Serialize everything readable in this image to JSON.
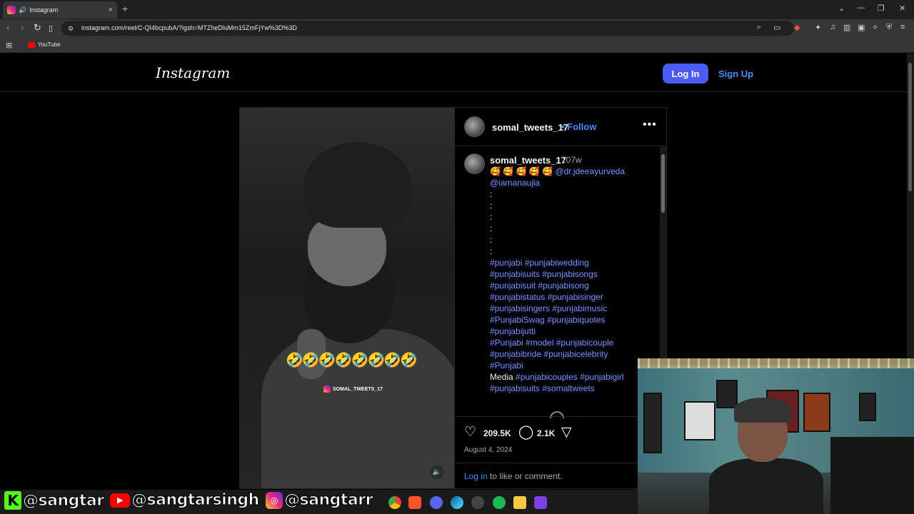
{
  "browser": {
    "tab_title": "Instagram",
    "tab_close": "×",
    "new_tab": "+",
    "url": "instagram.com/reel/C-QI4bcpubA/?igsh=MTZheDluMm15ZmFjYw%3D%3D",
    "bookmark_youtube": "YouTube"
  },
  "header": {
    "logo": "Instagram",
    "login_label": "Log In",
    "signup_label": "Sign Up"
  },
  "video": {
    "emoji_overlay": "🤣🤣🤣🤣🤣🤣🤣🤣",
    "watermark": "SOMAL_TWEETS_17"
  },
  "post": {
    "author": "somal_tweets_17",
    "follow_label": "Follow",
    "more_label": "•••",
    "caption_author": "somal_tweets_17",
    "time_ago": "107w",
    "caption_lines": [
      {
        "emoji": "🥰 🥰 🥰 🥰 🥰",
        "link": "@dr.jdeeayurveda"
      },
      {
        "link": "@iamanaujla"
      },
      {
        "text": ":"
      },
      {
        "text": ":"
      },
      {
        "text": ":"
      },
      {
        "text": ":"
      },
      {
        "text": ":"
      },
      {
        "text": ":"
      }
    ],
    "hashtag_lines": [
      "#punjabi #punjabiwedding",
      "#punjabisuits #punjabisongs",
      "#punjabisuit #punjabisong",
      "#punjabistatus #punjabisinger",
      "#punjabisingers #punjabimusic",
      "#PunjabiSwag #punjabiquotes",
      "#punjabijutti",
      "#Punjabi #model #punjabicouple",
      "#punjabibride #punjabicelebrity",
      "#Punjabi"
    ],
    "media_word": "Media",
    "media_tags": "#punjabicouples #punjabigirl",
    "last_tags": "#punjabisuits #somaltweets",
    "likes": "209.5K",
    "comments": "2.1K",
    "date": "August 4, 2024",
    "login_link": "Log in",
    "login_rest": " to like or comment."
  },
  "banner": {
    "kick_handle": "@sangtar",
    "youtube_handle": "@sangtarsingh",
    "instagram_handle": "@sangtarr"
  },
  "colors": {
    "accent_blue": "#4a5df9",
    "link_blue": "#4a8cf7",
    "hashtag_blue": "#7b93ff",
    "background": "#000000"
  }
}
